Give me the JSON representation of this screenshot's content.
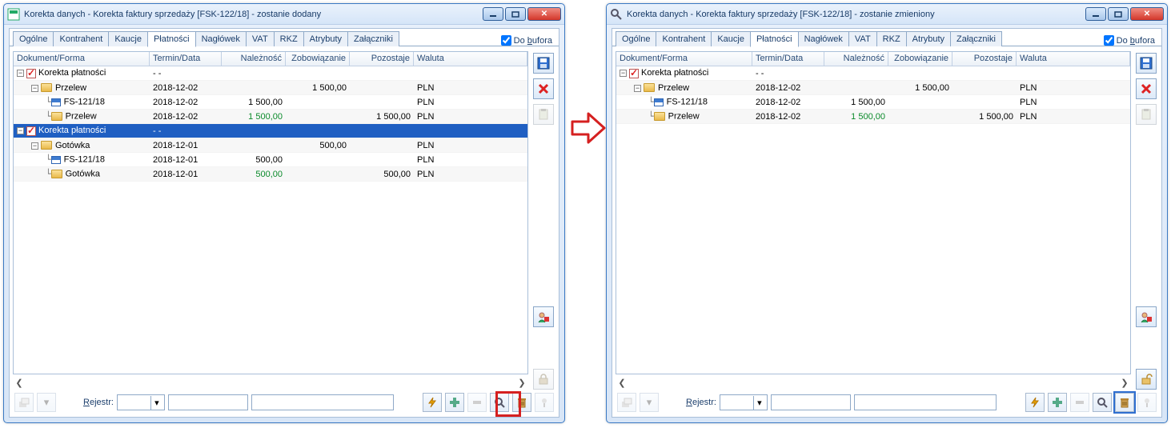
{
  "arrow_dir": "right",
  "left": {
    "title": "Korekta danych - Korekta faktury sprzedaży [FSK-122/18]  - zostanie dodany",
    "buffer_label": "Do bufora",
    "buffer_checked": true,
    "tabs": [
      "Ogólne",
      "Kontrahent",
      "Kaucje",
      "Płatności",
      "Nagłówek",
      "VAT",
      "RKZ",
      "Atrybuty",
      "Załączniki"
    ],
    "active_tab": 3,
    "rejestr_label": "Rejestr:",
    "headers": {
      "doc": "Dokument/Forma",
      "date": "Termin/Data",
      "nal": "Należność",
      "zob": "Zobowiązanie",
      "poz": "Pozostaje",
      "wal": "Waluta"
    },
    "rows": [
      {
        "depth": 0,
        "exp": "-",
        "check": true,
        "icon": "none",
        "label": "Korekta płatności",
        "date": "-  -",
        "nal": "",
        "zob": "",
        "poz": "",
        "wal": "",
        "sel": false
      },
      {
        "depth": 1,
        "exp": "-",
        "icon": "folder",
        "label": "Przelew",
        "date": "2018-12-02",
        "nal": "",
        "zob": "1 500,00",
        "poz": "",
        "wal": "PLN",
        "sel": false
      },
      {
        "depth": 2,
        "exp": "",
        "icon": "doc",
        "label": "FS-121/18",
        "date": "2018-12-02",
        "nal": "1 500,00",
        "zob": "",
        "poz": "",
        "wal": "PLN",
        "sel": false
      },
      {
        "depth": 2,
        "exp": "",
        "icon": "folder",
        "label": "Przelew",
        "date": "2018-12-02",
        "nal": "1 500,00",
        "zob": "",
        "poz": "1 500,00",
        "wal": "PLN",
        "green": true,
        "sel": false
      },
      {
        "depth": 0,
        "exp": "-",
        "check": true,
        "icon": "none",
        "label": "Korekta płatności",
        "date": "-  -",
        "nal": "",
        "zob": "",
        "poz": "",
        "wal": "",
        "sel": true
      },
      {
        "depth": 1,
        "exp": "-",
        "icon": "folder",
        "label": "Gotówka",
        "date": "2018-12-01",
        "nal": "",
        "zob": "500,00",
        "poz": "",
        "wal": "PLN",
        "sel": false
      },
      {
        "depth": 2,
        "exp": "",
        "icon": "doc",
        "label": "FS-121/18",
        "date": "2018-12-01",
        "nal": "500,00",
        "zob": "",
        "poz": "",
        "wal": "PLN",
        "sel": false
      },
      {
        "depth": 2,
        "exp": "",
        "icon": "folder",
        "label": "Gotówka",
        "date": "2018-12-01",
        "nal": "500,00",
        "zob": "",
        "poz": "500,00",
        "wal": "PLN",
        "green": true,
        "sel": false
      }
    ],
    "mark_delete": true
  },
  "right": {
    "title": "Korekta danych - Korekta faktury sprzedaży [FSK-122/18]  - zostanie zmieniony",
    "buffer_label": "Do bufora",
    "buffer_checked": true,
    "tabs": [
      "Ogólne",
      "Kontrahent",
      "Kaucje",
      "Płatności",
      "Nagłówek",
      "VAT",
      "RKZ",
      "Atrybuty",
      "Załączniki"
    ],
    "active_tab": 3,
    "rejestr_label": "Rejestr:",
    "headers": {
      "doc": "Dokument/Forma",
      "date": "Termin/Data",
      "nal": "Należność",
      "zob": "Zobowiązanie",
      "poz": "Pozostaje",
      "wal": "Waluta"
    },
    "rows": [
      {
        "depth": 0,
        "exp": "-",
        "check": true,
        "icon": "none",
        "label": "Korekta płatności",
        "date": "-  -",
        "nal": "",
        "zob": "",
        "poz": "",
        "wal": "",
        "sel": false
      },
      {
        "depth": 1,
        "exp": "-",
        "icon": "folder",
        "label": "Przelew",
        "date": "2018-12-02",
        "nal": "",
        "zob": "1 500,00",
        "poz": "",
        "wal": "PLN",
        "sel": false
      },
      {
        "depth": 2,
        "exp": "",
        "icon": "doc",
        "label": "FS-121/18",
        "date": "2018-12-02",
        "nal": "1 500,00",
        "zob": "",
        "poz": "",
        "wal": "PLN",
        "sel": false
      },
      {
        "depth": 2,
        "exp": "",
        "icon": "folder",
        "label": "Przelew",
        "date": "2018-12-02",
        "nal": "1 500,00",
        "zob": "",
        "poz": "1 500,00",
        "wal": "PLN",
        "green": true,
        "sel": false
      }
    ],
    "mark_delete": false,
    "lock_open": true
  },
  "icons": {
    "save": "save",
    "delete": "delete",
    "paste": "paste",
    "user": "user",
    "lock": "lock",
    "lock_open": "lock-open",
    "bolt": "bolt",
    "plus": "plus",
    "minus": "minus",
    "magnify": "magnify",
    "trash": "trash",
    "pin": "pin",
    "stack": "stack"
  }
}
